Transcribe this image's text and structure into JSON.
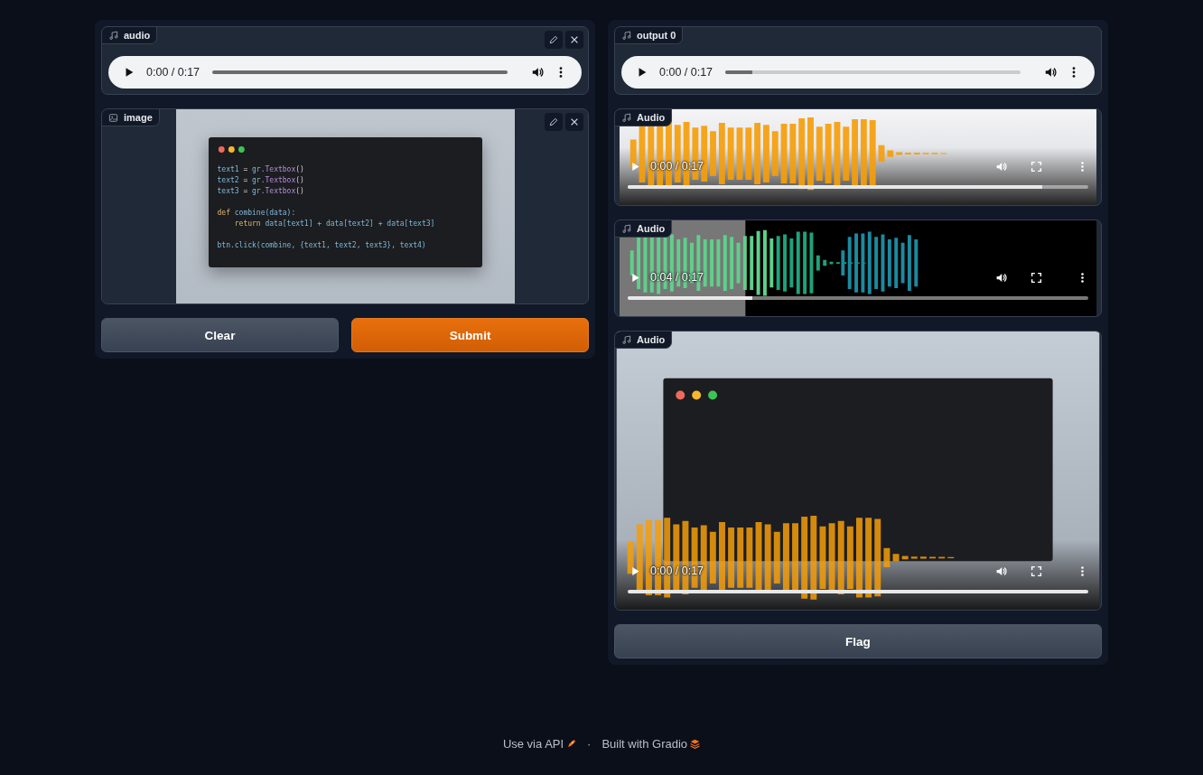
{
  "input": {
    "audio": {
      "label": "audio",
      "time": "0:00 / 0:17",
      "level": 1
    },
    "image": {
      "label": "image",
      "code": [
        [
          [
            {
              "text": "text1",
              "kind": "var"
            },
            {
              "text": " = ",
              "kind": "op"
            },
            {
              "text": "gr.",
              "kind": "var"
            },
            {
              "text": "Textbox",
              "kind": "cls"
            },
            {
              "text": "()",
              "kind": "op"
            }
          ],
          [
            {
              "text": "text2",
              "kind": "var"
            },
            {
              "text": " = ",
              "kind": "op"
            },
            {
              "text": "gr.",
              "kind": "var"
            },
            {
              "text": "Textbox",
              "kind": "cls"
            },
            {
              "text": "()",
              "kind": "op"
            }
          ],
          [
            {
              "text": "text3",
              "kind": "var"
            },
            {
              "text": " = ",
              "kind": "op"
            },
            {
              "text": "gr.",
              "kind": "var"
            },
            {
              "text": "Textbox",
              "kind": "cls"
            },
            {
              "text": "()",
              "kind": "op"
            }
          ]
        ],
        [
          [
            {
              "text": "def",
              "kind": "kw"
            },
            {
              "text": " combine(data):",
              "kind": "var"
            }
          ],
          [
            {
              "text": "    return",
              "kind": "kw"
            },
            {
              "text": " data[text1] + data[text2] + data[text3]",
              "kind": "var"
            }
          ]
        ],
        [
          [
            {
              "text": "btn.click(combine, {text1, text2, text3}, text4)",
              "kind": "var"
            }
          ]
        ]
      ]
    }
  },
  "buttons": [
    {
      "label": "Clear",
      "kind": "secondary"
    },
    {
      "label": "Submit",
      "kind": "primary"
    }
  ],
  "output": {
    "audio": {
      "label": "output 0",
      "time": "0:00 / 0:17",
      "level": 0.09
    },
    "videos": [
      {
        "label": "Audio",
        "time": "0:00 / 0:17",
        "level": 0.9,
        "kind": "light"
      },
      {
        "label": "Audio",
        "time": "0:04 / 0:17",
        "level": 0.27,
        "kind": "dark"
      },
      {
        "label": "Audio",
        "time": "0:00 / 0:17",
        "level": 1,
        "kind": "picture"
      }
    ],
    "flag": {
      "label": "Flag"
    }
  },
  "footer": [
    {
      "text": "Use via API",
      "kind": "api"
    },
    {
      "text": "·",
      "kind": "sep"
    },
    {
      "text": "Built with Gradio",
      "kind": "gradio"
    }
  ]
}
